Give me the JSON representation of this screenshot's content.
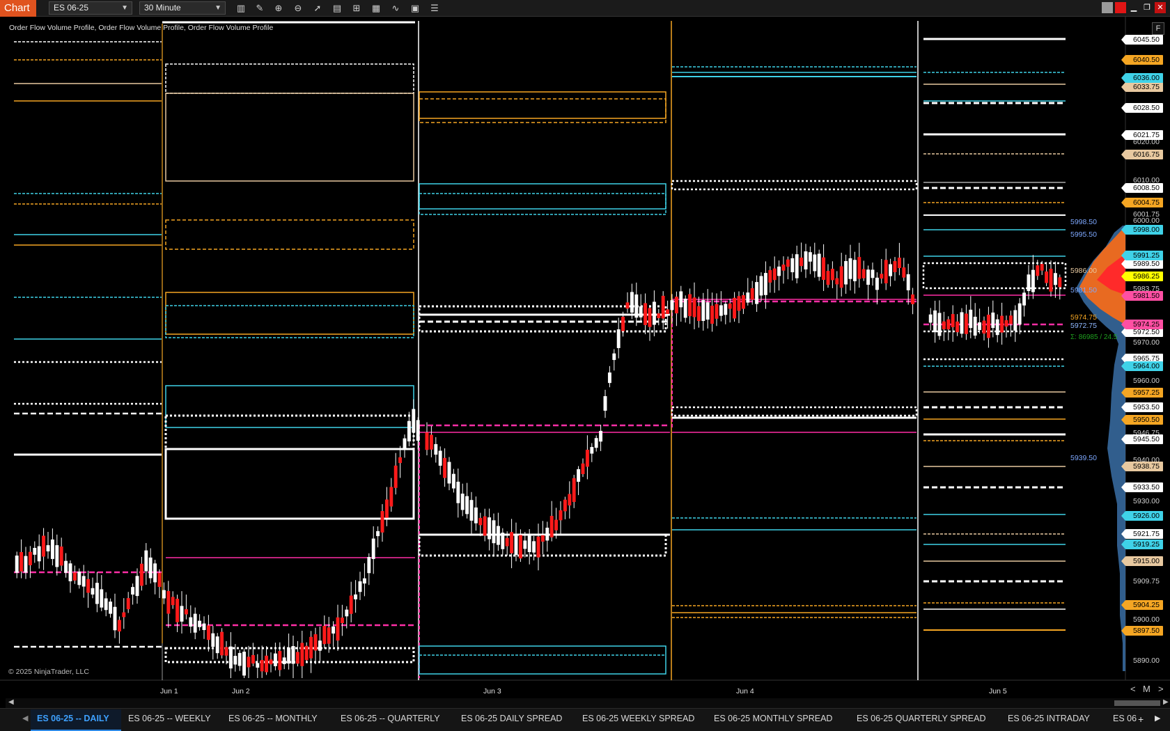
{
  "app": {
    "badge": "Chart"
  },
  "toolbar": {
    "instrument": "ES 06-25",
    "interval": "30 Minute",
    "icons": [
      "bars-type-icon",
      "draw-pencil-icon",
      "zoom-in-icon",
      "zoom-out-icon",
      "pointer-icon",
      "data-box-icon",
      "properties-icon",
      "strategies-icon",
      "indicators-icon",
      "chart-trader-icon",
      "list-icon"
    ],
    "window_controls": [
      "restore-gray-icon",
      "red-square-icon",
      "minimize-icon",
      "maximize-icon",
      "close-icon"
    ]
  },
  "chart": {
    "title": "Order Flow Volume Profile, Order Flow Volume Profile, Order Flow Volume Profile",
    "copyright": "© 2025 NinjaTrader, LLC",
    "axis_button": "F",
    "price_axis": {
      "plain": [
        "6020.00",
        "6001.75",
        "5970.00",
        "5960.00",
        "5930.00",
        "5909.75",
        "5900.00",
        "5890.00"
      ],
      "white_boxes": [
        "6045.50",
        "6028.50",
        "6021.75",
        "6008.50",
        "5989.50",
        "5972.50",
        "5965.75",
        "5953.50",
        "5945.50",
        "5933.50",
        "5921.75"
      ],
      "orange_boxes": [
        "6040.50",
        "6004.75",
        "5957.25",
        "5950.50",
        "5904.25",
        "5897.50"
      ],
      "tan_boxes": [
        "6033.75",
        "6016.75",
        "5938.75",
        "5915.00"
      ],
      "cyan_boxes": [
        "6036.00",
        "5998.00",
        "5991.25",
        "5964.00",
        "5926.00",
        "5919.25"
      ],
      "yellow_box": "5986.25",
      "pink_boxes": [
        "5981.50",
        "5974.25"
      ],
      "partial": [
        "6010.00",
        "6000.00",
        "5983.75",
        "5946.75",
        "5940.00"
      ]
    },
    "profile_tags": {
      "blue": [
        "5998.50",
        "5995.50",
        "5981.50",
        "5939.50"
      ],
      "orange": [
        "5974.75"
      ],
      "lightblue": [
        "5972.75"
      ],
      "tan": [
        "5986.00"
      ],
      "green": "Σ: 86985 / 24.5"
    },
    "date_axis": [
      "Jun 1",
      "Jun 2",
      "Jun 3",
      "Jun 4",
      "Jun 5"
    ],
    "zoom": {
      "minus": "<",
      "mode": "M",
      "plus": ">"
    }
  },
  "tabs": [
    "ES 06-25 -- DAILY",
    "ES 06-25 -- WEEKLY",
    "ES 06-25 -- MONTHLY",
    "ES 06-25 -- QUARTERLY",
    "ES 06-25 DAILY SPREAD",
    "ES 06-25 WEEKLY SPREAD",
    "ES 06-25 MONTHLY SPREAD",
    "ES 06-25 QUARTERLY SPREAD",
    "ES 06-25 INTRADAY",
    "ES 06"
  ],
  "colors": {
    "bg": "#000000",
    "toolbar": "#1b1b1b",
    "badge": "#e0531f",
    "white": "#ffffff",
    "orange": "#f5a623",
    "tan": "#e8c9a0",
    "cyan": "#3fd2e8",
    "magenta": "#ff2ea6",
    "pink_box": "#ff4fa3",
    "yellow_box": "#ffff00",
    "up_candle": "#ffffff",
    "down_candle": "#ff1a1a",
    "tab_active": "#3ea1ff"
  }
}
